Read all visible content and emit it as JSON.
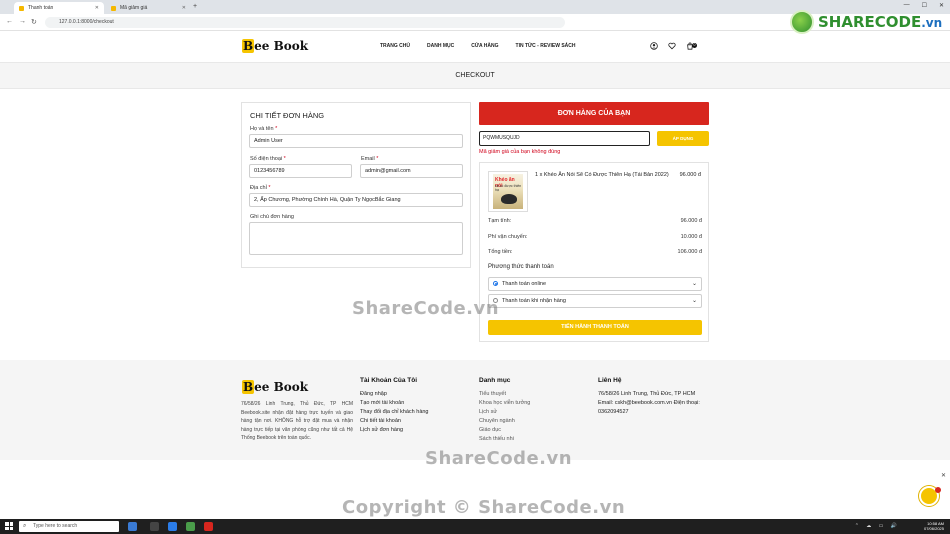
{
  "browser": {
    "tabs": [
      {
        "label": "Thanh toán",
        "active": true
      },
      {
        "label": "Mã giảm giá",
        "active": false
      }
    ],
    "url": "127.0.0.1:8000/checkout"
  },
  "header": {
    "logo": {
      "first": "B",
      "rest": "ee Book"
    },
    "nav": [
      "TRANG CHỦ",
      "DANH MỤC",
      "CỬA HÀNG",
      "TIN TỨC - REVIEW SÁCH"
    ],
    "cart_count": "0"
  },
  "page_title": "CHECKOUT",
  "order_form": {
    "title": "CHI TIẾT ĐƠN HÀNG",
    "name_label": "Họ và tên",
    "name_value": "Admin User",
    "phone_label": "Số điện thoại",
    "phone_value": "0123456789",
    "email_label": "Email",
    "email_value": "admin@gmail.com",
    "address_label": "Địa chỉ",
    "address_value": "2, Ấp Chương, Phường Chính Hà, Quận Ty NgọcBắc Giang",
    "note_label": "Ghi chú đơn hàng",
    "required_mark": "*"
  },
  "summary": {
    "title": "ĐƠN HÀNG CỦA BẠN",
    "coupon_value": "PQWMUSQUJD",
    "apply_label": "ÁP DỤNG",
    "coupon_error": "Mã giảm giá của bạn không đúng",
    "book_cover_title": "Khéo ăn nói",
    "book_cover_sub": "sẽ có được thiên hạ",
    "item_name": "1 x Khéo Ăn Nói Sẽ Có Được Thiên Hạ (Tái Bản 2022)",
    "item_price": "96.000 đ",
    "subtotal_label": "Tạm tính:",
    "subtotal_value": "96.000 đ",
    "shipping_label": "Phí vận chuyển:",
    "shipping_value": "10.000 đ",
    "total_label": "Tổng tiền:",
    "total_value": "106.000 đ",
    "payment_title": "Phương thức thanh toán",
    "payment_options": [
      "Thanh toán online",
      "Thanh toán khi nhận hàng"
    ],
    "submit_label": "TIẾN HÀNH THANH TOÁN"
  },
  "footer": {
    "about": "76/58/26 Linh Trung, Thủ Đức, TP HCM Beebook.site nhận đặt hàng trực tuyến và giao hàng tận nơi. KHÔNG hỗ trợ đặt mua và nhận hàng trực tiếp tại văn phòng cũng như tất cả Hệ Thống Beebook trên toàn quốc.",
    "account": {
      "title": "Tài Khoản Của Tôi",
      "links": [
        "Đăng nhập",
        "Tạo mới tài khoản",
        "Thay đổi địa chỉ khách hàng",
        "Chi tiết tài khoản",
        "Lịch sử đơn hàng"
      ]
    },
    "categories": {
      "title": "Danh mục",
      "links": [
        "Tiểu thuyết",
        "Khoa học viễn tưởng",
        "Lịch sử",
        "Chuyên ngành",
        "Giáo dục",
        "Sách thiếu nhi"
      ]
    },
    "contact": {
      "title": "Liên Hệ",
      "address": "76/58/26 Linh Trung, Thủ Đức, TP HCM",
      "email_line": "Email: cskh@beebook.com.vn Điện thoại:",
      "phone": "0362094527"
    }
  },
  "watermarks": {
    "brand": "SHARECODE",
    "brand_suffix": ".vn",
    "mid": "ShareCode.vn",
    "copyright": "Copyright © ShareCode.vn"
  },
  "taskbar": {
    "search_placeholder": "Type here to search",
    "time": "10:58 AM",
    "date": "07/06/2025"
  },
  "colors": {
    "accent_red": "#d7261e",
    "accent_yellow": "#f5c400",
    "error": "#d0021b"
  }
}
